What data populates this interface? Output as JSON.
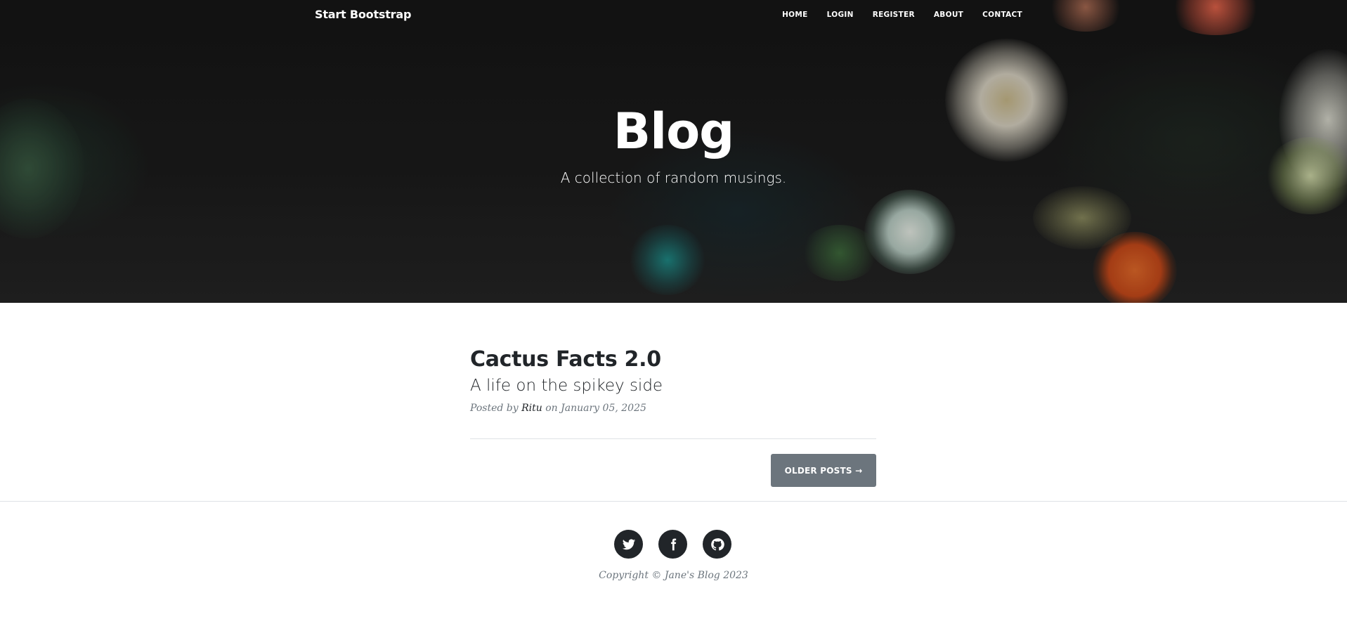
{
  "nav": {
    "brand": "Start Bootstrap",
    "links": [
      "Home",
      "Login",
      "Register",
      "About",
      "Contact"
    ]
  },
  "hero": {
    "title": "Blog",
    "subtitle": "A collection of random musings."
  },
  "post": {
    "title": "Cactus Facts 2.0",
    "subtitle": "A life on the spikey side",
    "meta_prefix": "Posted by",
    "author": "Ritu",
    "meta_date": "on January 05, 2025"
  },
  "pager": {
    "older_label": "Older Posts →"
  },
  "footer": {
    "social": [
      "twitter-icon",
      "facebook-icon",
      "github-icon"
    ],
    "copyright": "Copyright © Jane's Blog 2023"
  },
  "colors": {
    "text_dark": "#212529",
    "muted": "#6c757d",
    "button_bg": "#6c757d",
    "divider": "#dee2e6"
  }
}
